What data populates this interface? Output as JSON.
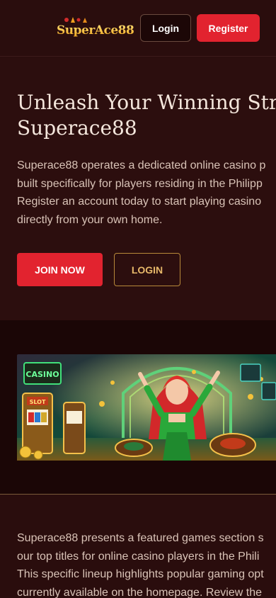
{
  "header": {
    "logo_text": "SuperAce88",
    "login_label": "Login",
    "register_label": "Register"
  },
  "hero": {
    "title_line1": "Unleash Your Winning Streak",
    "title_line2": "Superace88",
    "desc_lines": [
      "Superace88 operates a dedicated online casino p",
      "built specifically for players residing in the Philipp",
      "Register an account today to start playing casino",
      "directly from your own home."
    ],
    "join_label": "JOIN NOW",
    "login_label": "LOGIN"
  },
  "banner": {
    "casino_sign": "CASINO",
    "slot_sign": "SLOT"
  },
  "games": {
    "desc_lines": [
      "Superace88 presents a featured games section s",
      "our top titles for online casino players in the Phili",
      "This specific lineup highlights popular gaming opt",
      "currently available on the homepage. Review the"
    ]
  },
  "colors": {
    "background": "#2a0d0d",
    "accent_red": "#e2232f",
    "gold": "#e7b86a"
  }
}
